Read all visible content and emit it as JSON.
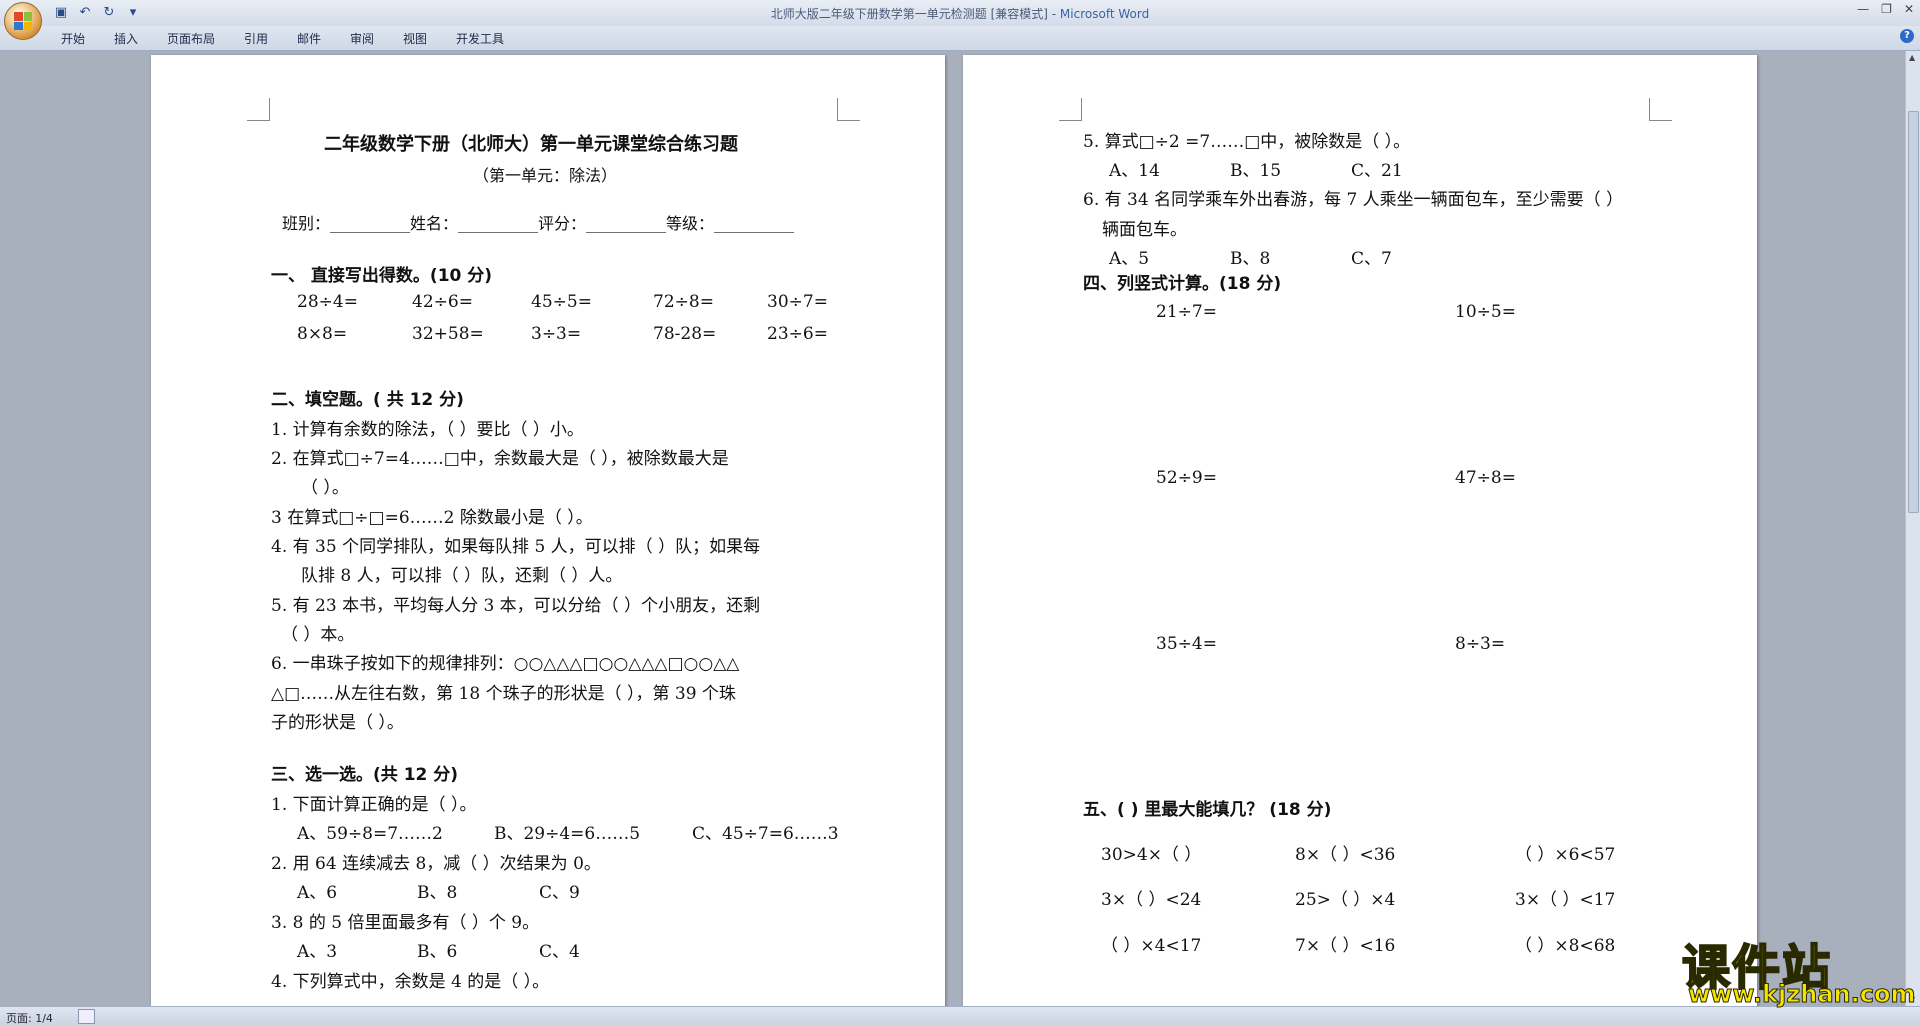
{
  "window": {
    "title_doc": "北师大版二年级下册数学第一单元检测题 [兼容模式] - ",
    "title_app": "Microsoft Word"
  },
  "ribbon": {
    "tabs": [
      "开始",
      "插入",
      "页面布局",
      "引用",
      "邮件",
      "审阅",
      "视图",
      "开发工具"
    ]
  },
  "status": {
    "page": "页面: 1/4"
  },
  "watermark": {
    "brand": "课件站",
    "url": "www.kjzhan.com"
  },
  "page1": {
    "title": "二年级数学下册（北师大）第一单元课堂综合练习题",
    "subtitle": "（第一单元：除法）",
    "info_line": "班别：__________姓名：__________评分：__________等级：__________",
    "s1_heading": "一、  直接写出得数。(10 分)",
    "s1_row1": [
      "28÷4=",
      "42÷6=",
      "45÷5=",
      "72÷8=",
      "30÷7="
    ],
    "s1_row2": [
      "8×8=",
      "32+58=",
      "3÷3=",
      "78-28=",
      "23÷6="
    ],
    "s2_heading": "二、填空题。( 共 12 分)",
    "s2_lines": [
      "1. 计算有余数的除法，（     ）要比（     ）小。",
      "2. 在算式□÷7=4……□中，余数最大是（     ），被除数最大是",
      "（     ）。",
      "3 在算式□÷□=6……2 除数最小是（       ）。",
      "4. 有 35 个同学排队，如果每队排 5 人，可以排（     ）队；如果每",
      "队排 8 人，可以排（     ）队，还剩（     ）人。",
      "5. 有 23 本书，平均每人分 3 本，可以分给（     ）个小朋友，还剩",
      "（     ）本。",
      "6. 一串珠子按如下的规律排列：○○△△△□○○△△△□○○△△",
      "△□……从左往右数，第 18 个珠子的形状是（     ），第 39 个珠",
      "子的形状是（        ）。"
    ],
    "s3_heading": "三、选一选。(共 12 分)",
    "s3_lines": [
      "1. 下面计算正确的是（      ）。",
      "2. 用 64 连续减去 8，减（      ）次结果为 0。",
      "3. 8 的 5 倍里面最多有（      ）个 9。",
      "4. 下列算式中，余数是 4 的是（      ）。"
    ],
    "s3_opts1": [
      "A、59÷8=7……2",
      "B、29÷4=6……5",
      "C、45÷7=6……3"
    ],
    "s3_opts2": [
      "A、6",
      "B、8",
      "C、9"
    ],
    "s3_opts3": [
      "A、3",
      "B、6",
      "C、4"
    ]
  },
  "page2": {
    "q5": "5. 算式□÷2 =7……□中，被除数是（      ）。",
    "q5_opts": [
      "A、14",
      "B、15",
      "C、21"
    ],
    "q6_a": "6. 有 34 名同学乘车外出春游，每 7 人乘坐一辆面包车，至少需要（      ）",
    "q6_b": "辆面包车。",
    "q6_opts": [
      "A、5",
      "B、8",
      "C、7"
    ],
    "s4_heading": "四、列竖式计算。(18 分)",
    "s4_rows": [
      [
        "21÷7=",
        "10÷5="
      ],
      [
        "52÷9=",
        "47÷8="
      ],
      [
        "35÷4=",
        "8÷3="
      ]
    ],
    "s5_heading": "五、(      ) 里最大能填几？ (18 分)",
    "s5_rows": [
      [
        "30>4×（     ）",
        "8×（     ）<36",
        "（     ）×6<57"
      ],
      [
        "3×（     ）<24",
        "25>（     ）×4",
        "3×（     ）<17"
      ],
      [
        "（     ）×4<17",
        "7×（     ）<16",
        "（     ）×8<68"
      ]
    ]
  }
}
